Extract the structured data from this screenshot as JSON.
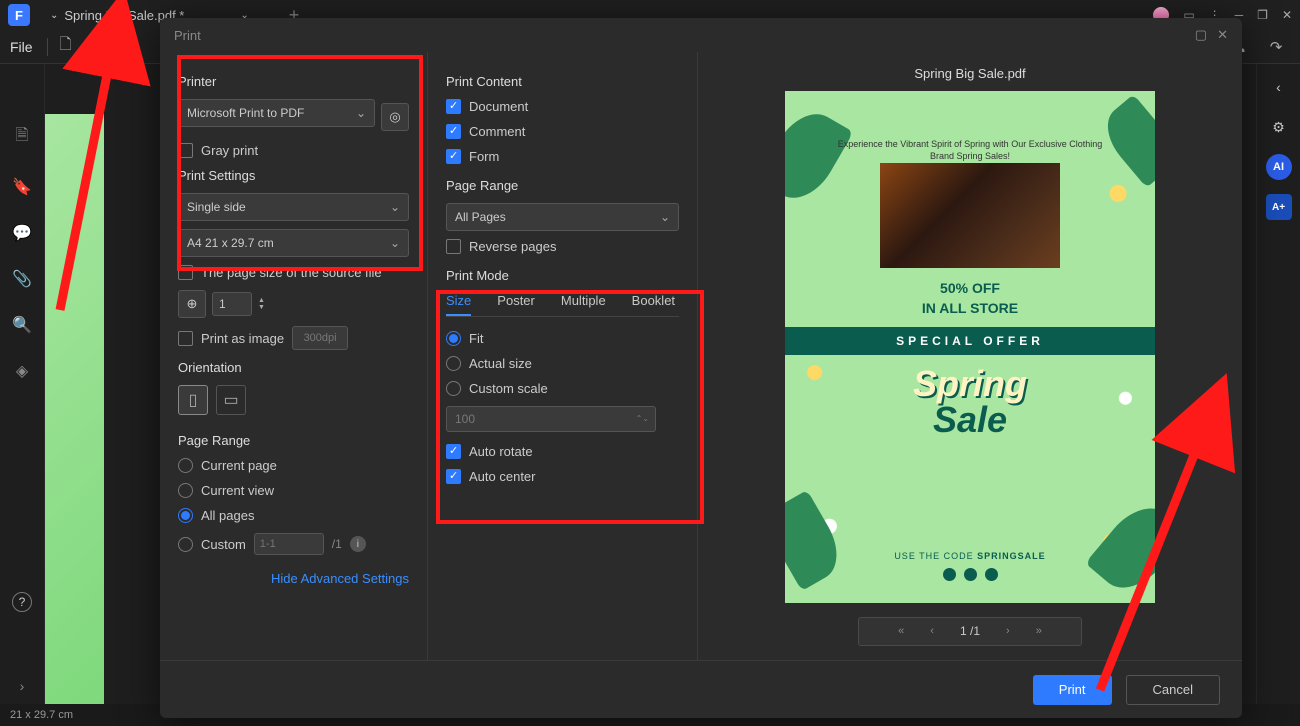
{
  "titlebar": {
    "logo_letter": "F",
    "tab_title": "Spring Big Sale.pdf *",
    "new_tab": "+"
  },
  "toolbar": {
    "file": "File"
  },
  "dialog": {
    "title": "Print",
    "printer_section": "Printer",
    "printer_value": "Microsoft Print to PDF",
    "gray_print": "Gray print",
    "print_settings": "Print Settings",
    "sides_value": "Single side",
    "paper_value": "A4 21 x 29.7 cm",
    "source_size": "The page size of the source file",
    "copies_value": "1",
    "print_as_image": "Print as image",
    "dpi_value": "300dpi",
    "orientation": "Orientation",
    "page_range_section": "Page Range",
    "pr_current_page": "Current page",
    "pr_current_view": "Current view",
    "pr_all_pages": "All pages",
    "pr_custom": "Custom",
    "pr_custom_placeholder": "1-1",
    "pr_custom_total": "/1",
    "advanced_link": "Hide Advanced Settings",
    "print_content": "Print Content",
    "pc_document": "Document",
    "pc_comment": "Comment",
    "pc_form": "Form",
    "page_range2": "Page Range",
    "range_value": "All Pages",
    "reverse": "Reverse pages",
    "print_mode": "Print Mode",
    "tabs": {
      "size": "Size",
      "poster": "Poster",
      "multiple": "Multiple",
      "booklet": "Booklet"
    },
    "pm_fit": "Fit",
    "pm_actual": "Actual size",
    "pm_custom": "Custom scale",
    "pm_scale_placeholder": "100",
    "pm_auto_rotate": "Auto rotate",
    "pm_auto_center": "Auto center"
  },
  "preview": {
    "filename": "Spring Big Sale.pdf",
    "tagline": "Experience the Vibrant Spirit of Spring with Our Exclusive Clothing Brand Spring Sales!",
    "off_line1": "50% OFF",
    "off_line2": "IN ALL STORE",
    "band": "SPECIAL OFFER",
    "big1": "Spring",
    "big2": "Sale",
    "code_prefix": "USE THE CODE ",
    "code": "SPRINGSALE",
    "pager": {
      "current": "1",
      "sep": "/",
      "total": "1"
    }
  },
  "footer": {
    "print": "Print",
    "cancel": "Cancel"
  },
  "statusbar": {
    "dims": "21 x 29.7 cm"
  },
  "rightrail": {
    "ai": "AI",
    "aplus": "A+"
  }
}
